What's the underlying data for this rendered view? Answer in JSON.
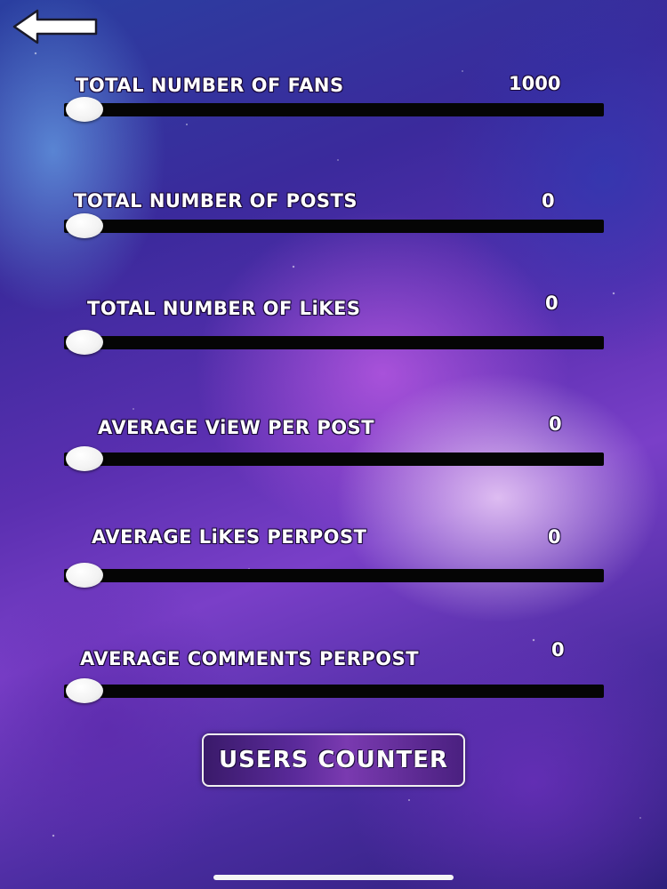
{
  "header": {
    "back_icon": "arrow-left-icon"
  },
  "sliders": [
    {
      "label": "TOTAL NUMBER  OF FANS",
      "value": "1000",
      "level": 0
    },
    {
      "label": "TOTAL NUMBER  OF POSTS",
      "value": "0",
      "level": 0
    },
    {
      "label": "TOTAL NUMBER  OF LiKES",
      "value": "0",
      "level": 0
    },
    {
      "label": "AVERAGE ViEW PER POST",
      "value": "0",
      "level": 0
    },
    {
      "label": "AVERAGE LiKES PERPOST",
      "value": "0",
      "level": 0
    },
    {
      "label": "AVERAGE COMMENTS PERPOST",
      "value": "0",
      "level": 0
    }
  ],
  "action": {
    "button_label": "USERS  COUNTER"
  },
  "colors": {
    "track": "#050505",
    "thumb": "#f2f2f2",
    "text": "#ffffff"
  }
}
